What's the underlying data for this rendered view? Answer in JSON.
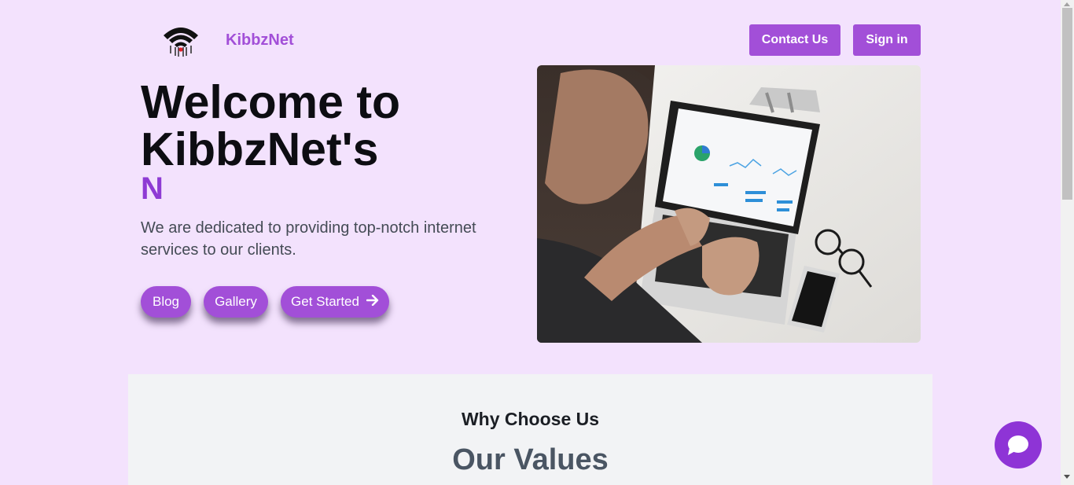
{
  "header": {
    "brand": "KibbzNet",
    "contact_label": "Contact Us",
    "signin_label": "Sign in"
  },
  "hero": {
    "title_line1": "Welcome to",
    "title_line2": "KibbzNet's",
    "typed_text": "N",
    "description": "We are dedicated to providing top-notch internet services to our clients.",
    "buttons": {
      "blog": "Blog",
      "gallery": "Gallery",
      "get_started": "Get Started"
    }
  },
  "values_section": {
    "kicker": "Why Choose Us",
    "heading": "Our Values"
  },
  "icons": {
    "logo": "wifi-logo-icon",
    "get_started": "arrow-right-icon",
    "chat": "chat-bubble-icon"
  },
  "colors": {
    "background": "#f3e2fd",
    "accent": "#a24fd8",
    "chat": "#8e34d6",
    "section_bg": "#f2f3f5"
  }
}
